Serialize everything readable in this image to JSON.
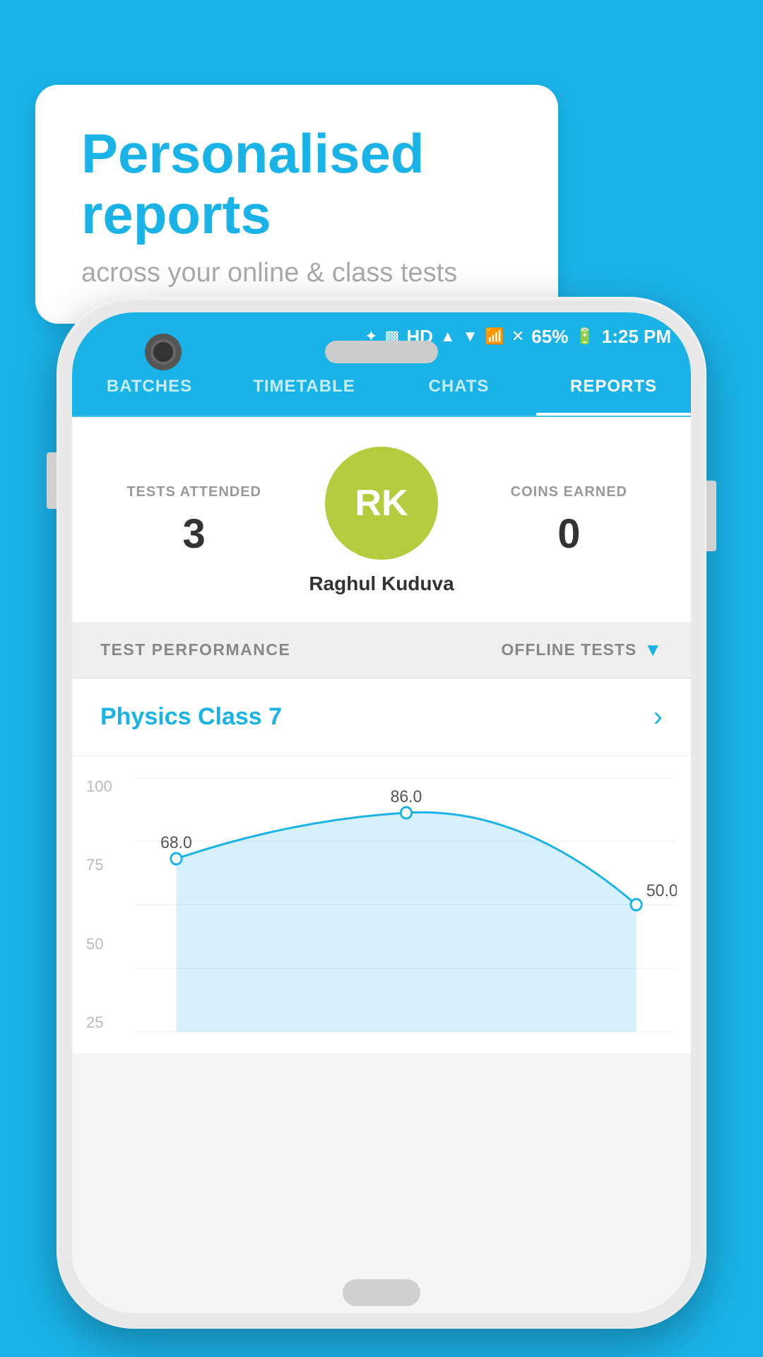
{
  "background": {
    "color": "#1ab3e8"
  },
  "speech_bubble": {
    "title": "Personalised reports",
    "subtitle": "across your online & class tests"
  },
  "status_bar": {
    "time": "1:25 PM",
    "battery": "65%",
    "signal_icons": "🔵 📳 HD ▲ ▼ 📶 ✕"
  },
  "nav_tabs": [
    {
      "label": "BATCHES",
      "active": false
    },
    {
      "label": "TIMETABLE",
      "active": false
    },
    {
      "label": "CHATS",
      "active": false
    },
    {
      "label": "REPORTS",
      "active": true
    }
  ],
  "profile": {
    "tests_attended_label": "TESTS ATTENDED",
    "tests_attended_value": "3",
    "coins_earned_label": "COINS EARNED",
    "coins_earned_value": "0",
    "avatar_initials": "RK",
    "user_name": "Raghul Kuduva"
  },
  "performance": {
    "section_label": "TEST PERFORMANCE",
    "filter_label": "OFFLINE TESTS",
    "class_name": "Physics Class 7",
    "chart": {
      "y_labels": [
        "100",
        "75",
        "50",
        "25"
      ],
      "data_points": [
        {
          "x": 0,
          "y": 68.0,
          "label": "68.0"
        },
        {
          "x": 1,
          "y": 86.0,
          "label": "86.0"
        },
        {
          "x": 2,
          "y": 50.0,
          "label": "50.0"
        }
      ]
    }
  }
}
